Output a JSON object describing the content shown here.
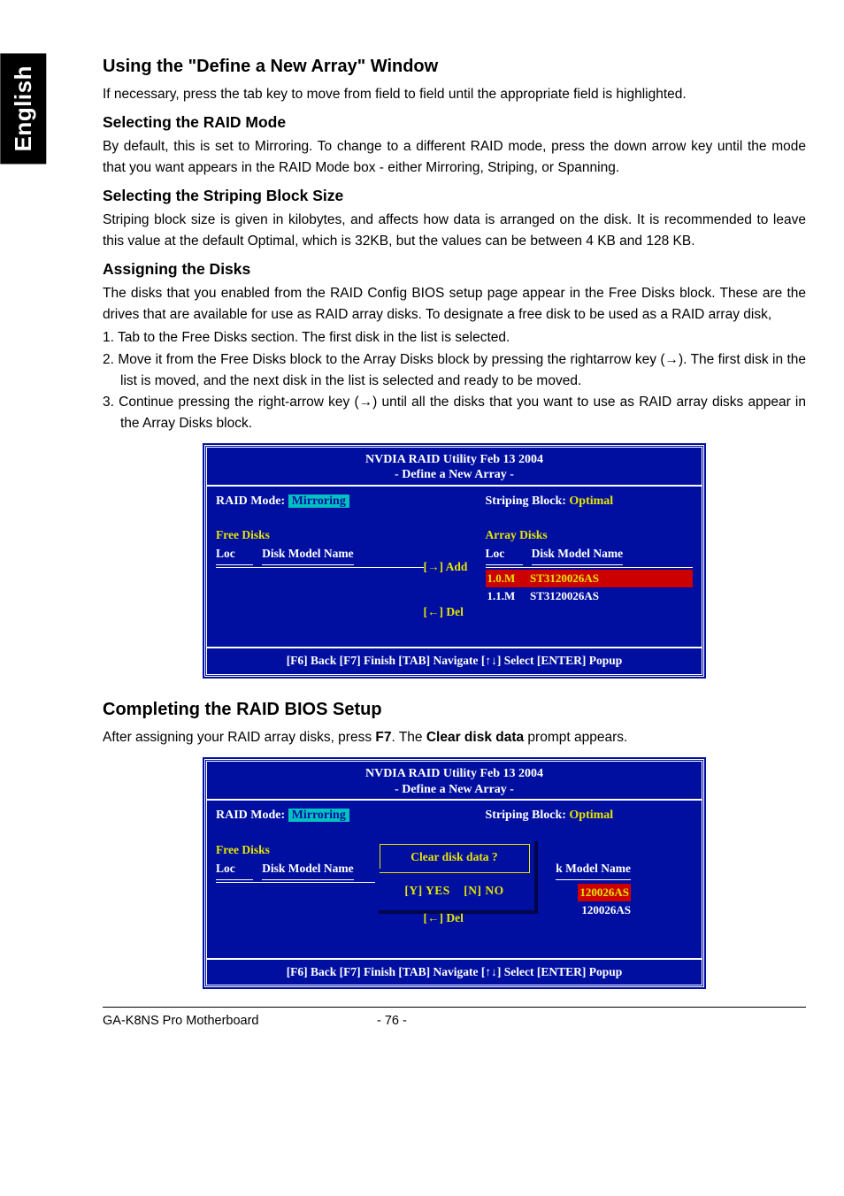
{
  "sidebar": {
    "label": "English"
  },
  "sections": {
    "s1_title": "Using the \"Define a New Array\" Window",
    "s1_p1": "If necessary, press the tab key to move from field to field until the appropriate field is highlighted.",
    "s1_h2a": "Selecting the RAID Mode",
    "s1_p2": "By default, this is set to Mirroring. To change to a different RAID mode, press the down arrow key until the mode that you want appears in the RAID Mode box - either Mirroring, Striping, or Spanning.",
    "s1_h2b": "Selecting the Striping Block Size",
    "s1_p3": "Striping block size is given in kilobytes, and affects how data is arranged on the disk. It is recommended to leave this value at the default Optimal, which is 32KB, but the values can be between 4 KB and 128 KB.",
    "s1_h2c": "Assigning the Disks",
    "s1_p4": "The disks that you enabled from the RAID Config BIOS setup page appear in the Free Disks block. These are the drives that are available for use as RAID array disks. To designate a free disk to be used as a RAID array disk,",
    "s1_step1": "1. Tab to the Free Disks section. The first disk in the list is selected.",
    "s1_step2": "2. Move it from the Free Disks block to the Array Disks block by pressing the rightarrow key (→). The first disk in the list is moved, and the next disk in the list is selected and ready to be moved.",
    "s1_step3": "3. Continue pressing the right-arrow key (→) until all the disks that you want to use as RAID array disks appear in the Array Disks block.",
    "s2_title": "Completing the RAID BIOS Setup",
    "s2_p1_a": "After assigning your RAID array disks, press ",
    "s2_p1_b": "F7",
    "s2_p1_c": ". The ",
    "s2_p1_d": "Clear disk data",
    "s2_p1_e": " prompt appears."
  },
  "raid": {
    "header_line1": "NVDIA RAID Utility   Feb 13 2004",
    "header_line2": "- Define a New Array -",
    "raid_mode_label": "RAID Mode:",
    "raid_mode_value": "Mirroring",
    "striping_label": "Striping Block:",
    "striping_value": "Optimal",
    "free_disks_label": "Free Disks",
    "array_disks_label": "Array Disks",
    "loc_label": "Loc",
    "model_label": "Disk Model Name",
    "model_label_obscured": "k Model Name",
    "add_label": "[→] Add",
    "del_label": "[←] Del",
    "footer_text": "[F6] Back   [F7] Finish   [TAB] Navigate   [↑↓] Select   [ENTER] Popup",
    "disk1_loc": "1.0.M",
    "disk1_model": "ST3120026AS",
    "disk2_loc": "1.1.M",
    "disk2_model": "ST3120026AS",
    "disk1_model_obscured": "120026AS",
    "disk2_model_obscured": "120026AS",
    "popup_title": "Clear disk data ?",
    "popup_yes": "[Y] YES",
    "popup_no": "[N] NO"
  },
  "footer": {
    "product": "GA-K8NS Pro Motherboard",
    "page": "- 76 -"
  }
}
